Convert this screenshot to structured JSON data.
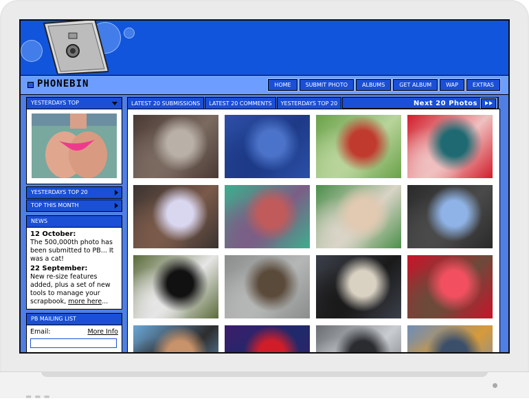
{
  "site": {
    "logo": "PHONEBIN"
  },
  "nav": [
    "HOME",
    "SUBMIT PHOTO",
    "ALBUMS",
    "GET ALBUM",
    "WAP",
    "EXTRAS"
  ],
  "left": {
    "yesterdays_top": "YESTERDAYS TOP",
    "yesterdays_top_20": "YESTERDAYS TOP 20",
    "top_this_month": "TOP THIS MONTH",
    "news_title": "NEWS",
    "news": [
      {
        "date": "12 October:",
        "text": "The 500,000th photo has been submitted to PB... It was a cat!"
      },
      {
        "date": "22 September:",
        "text": "New re-size features added, plus a set of new tools to manage your scrapbook,",
        "link": "more here",
        "tail": "..."
      }
    ],
    "mailing_title": "PB MAILING LIST",
    "email_label": "Email:",
    "more_info": "More Info"
  },
  "tabs": [
    "LATEST 20 SUBMISSIONS",
    "LATEST 20 COMMENTS",
    "YESTERDAYS TOP 20"
  ],
  "next_label": "Next 20 Photos",
  "photos": [
    {
      "subject": "ferret on bottle",
      "colors": [
        "#4a3a34",
        "#b9b0a8",
        "#7a6a60"
      ]
    },
    {
      "subject": "airplane in sky",
      "colors": [
        "#2c4fa6",
        "#4b73c9",
        "#1d3a87"
      ]
    },
    {
      "subject": "person in park with red umbrella",
      "colors": [
        "#6aa24a",
        "#c13a2e",
        "#b8d49a"
      ]
    },
    {
      "subject": "red hair doll",
      "colors": [
        "#d11d2a",
        "#1f6a72",
        "#f0c0c0"
      ]
    },
    {
      "subject": "welding sparks",
      "colors": [
        "#3b3330",
        "#d9d6f0",
        "#7a5a4a"
      ]
    },
    {
      "subject": "tattoo arm",
      "colors": [
        "#3eae8d",
        "#c15b5b",
        "#7b5e86"
      ]
    },
    {
      "subject": "person in toilet",
      "colors": [
        "#4b8f4a",
        "#e2c9b1",
        "#d9d4c7"
      ]
    },
    {
      "subject": "lost sign on ground",
      "colors": [
        "#2a2a2a",
        "#8fb3e6",
        "#4a4a4a"
      ]
    },
    {
      "subject": "cat in tree",
      "colors": [
        "#5b6b3a",
        "#111111",
        "#e6e6e6"
      ]
    },
    {
      "subject": "squirrel",
      "colors": [
        "#8a8d8c",
        "#5a4a3a",
        "#b5b7b6"
      ]
    },
    {
      "subject": "costumed people",
      "colors": [
        "#3b3f49",
        "#d9d2c3",
        "#1a1a1a"
      ]
    },
    {
      "subject": "man in red tube",
      "colors": [
        "#c8142a",
        "#f25060",
        "#6c4a3a"
      ]
    },
    {
      "subject": "beach faces",
      "colors": [
        "#6aa6d6",
        "#c8926a",
        "#2d2d2d"
      ]
    },
    {
      "subject": "neon sign",
      "colors": [
        "#3b1d6b",
        "#d11d2a",
        "#1f2a6b"
      ]
    },
    {
      "subject": "less sign",
      "colors": [
        "#6a6e73",
        "#2a2c30",
        "#c9ccd0"
      ]
    },
    {
      "subject": "crowd blue",
      "colors": [
        "#6f8db5",
        "#3b4f6b",
        "#d69a3a"
      ]
    }
  ]
}
